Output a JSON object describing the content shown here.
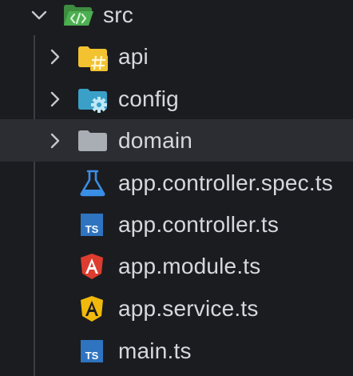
{
  "explorer": {
    "root": {
      "label": "src",
      "icon": "folder-src-open-icon",
      "expanded": true
    },
    "items": [
      {
        "label": "api",
        "kind": "folder",
        "icon": "folder-api-icon",
        "expanded": false
      },
      {
        "label": "config",
        "kind": "folder",
        "icon": "folder-config-icon",
        "expanded": false
      },
      {
        "label": "domain",
        "kind": "folder",
        "icon": "folder-icon",
        "expanded": false,
        "hovered": true
      },
      {
        "label": "app.controller.spec.ts",
        "kind": "file",
        "icon": "test-flask-icon"
      },
      {
        "label": "app.controller.ts",
        "kind": "file",
        "icon": "typescript-icon"
      },
      {
        "label": "app.module.ts",
        "kind": "file",
        "icon": "angular-module-icon"
      },
      {
        "label": "app.service.ts",
        "kind": "file",
        "icon": "angular-service-icon"
      },
      {
        "label": "main.ts",
        "kind": "file",
        "icon": "typescript-icon"
      }
    ]
  },
  "colors": {
    "background": "#1b1c20",
    "hover_row": "#2b2d33",
    "text": "#d6d8dd",
    "chevron": "#c5c7cc",
    "src_folder": "#4caf50",
    "api_folder": "#f2c230",
    "config_folder": "#3aa0c8",
    "plain_folder": "#a9adb4",
    "typescript": "#2f74c0",
    "angular_module": "#dd3c2f",
    "angular_service": "#f0b90b",
    "test_flask": "#3a8ee6"
  }
}
